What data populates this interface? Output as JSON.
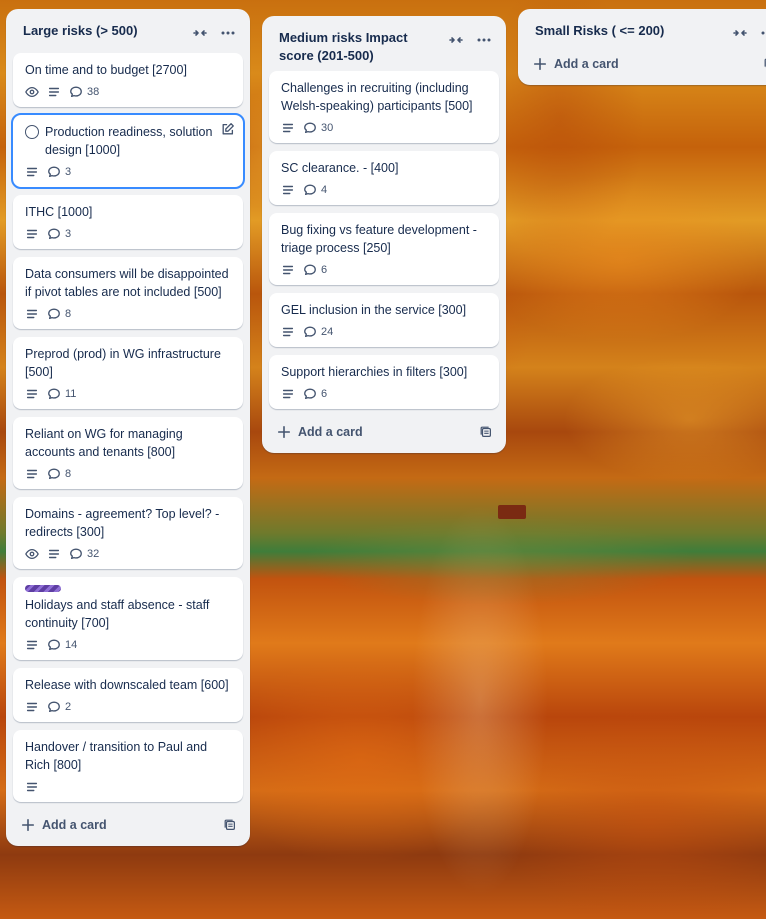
{
  "lists": [
    {
      "title": "Large risks (> 500)",
      "add_card_label": "Add a card",
      "cards": [
        {
          "title": "On time and to budget [2700]",
          "watch": true,
          "description": true,
          "comments": "38"
        },
        {
          "title": "Production readiness, solution design [1000]",
          "focused": true,
          "description": true,
          "comments": "3"
        },
        {
          "title": "ITHC [1000]",
          "description": true,
          "comments": "3"
        },
        {
          "title": "Data consumers will be disappointed if pivot tables are not included [500]",
          "description": true,
          "comments": "8"
        },
        {
          "title": "Preprod (prod) in WG infrastructure [500]",
          "description": true,
          "comments": "11"
        },
        {
          "title": "Reliant on WG for managing accounts and tenants [800]",
          "description": true,
          "comments": "8"
        },
        {
          "title": "Domains - agreement? Top level? - redirects [300]",
          "watch": true,
          "description": true,
          "comments": "32"
        },
        {
          "title": "Holidays and staff absence - staff continuity [700]",
          "label": true,
          "description": true,
          "comments": "14"
        },
        {
          "title": "Release with downscaled team [600]",
          "description": true,
          "comments": "2"
        },
        {
          "title": "Handover / transition to Paul and Rich [800]",
          "description": true
        }
      ]
    },
    {
      "title": "Medium risks Impact score (201-500)",
      "add_card_label": "Add a card",
      "cards": [
        {
          "title": "Challenges in recruiting (including Welsh-speaking) participants [500]",
          "description": true,
          "comments": "30"
        },
        {
          "title": "SC clearance. - [400]",
          "description": true,
          "comments": "4"
        },
        {
          "title": "Bug fixing vs feature development - triage process [250]",
          "description": true,
          "comments": "6"
        },
        {
          "title": "GEL inclusion in the service [300]",
          "description": true,
          "comments": "24"
        },
        {
          "title": "Support hierarchies in filters [300]",
          "description": true,
          "comments": "6"
        }
      ]
    },
    {
      "title": "Small Risks ( <= 200)",
      "add_card_label": "Add a card",
      "cards": []
    }
  ],
  "colors": {
    "list_bg": "#f1f2f4",
    "card_bg": "#ffffff",
    "focus_outline": "#388bff",
    "label_purple": "#5e3ea3",
    "text": "#172b4d",
    "muted": "#44546f"
  },
  "icons": {
    "collapse": "collapse-icon",
    "more": "more-icon",
    "watch": "eye-icon",
    "description": "description-icon",
    "comments": "comment-icon",
    "add": "plus-icon",
    "template": "template-icon",
    "edit": "edit-icon",
    "complete": "checkbox-circle-icon"
  }
}
